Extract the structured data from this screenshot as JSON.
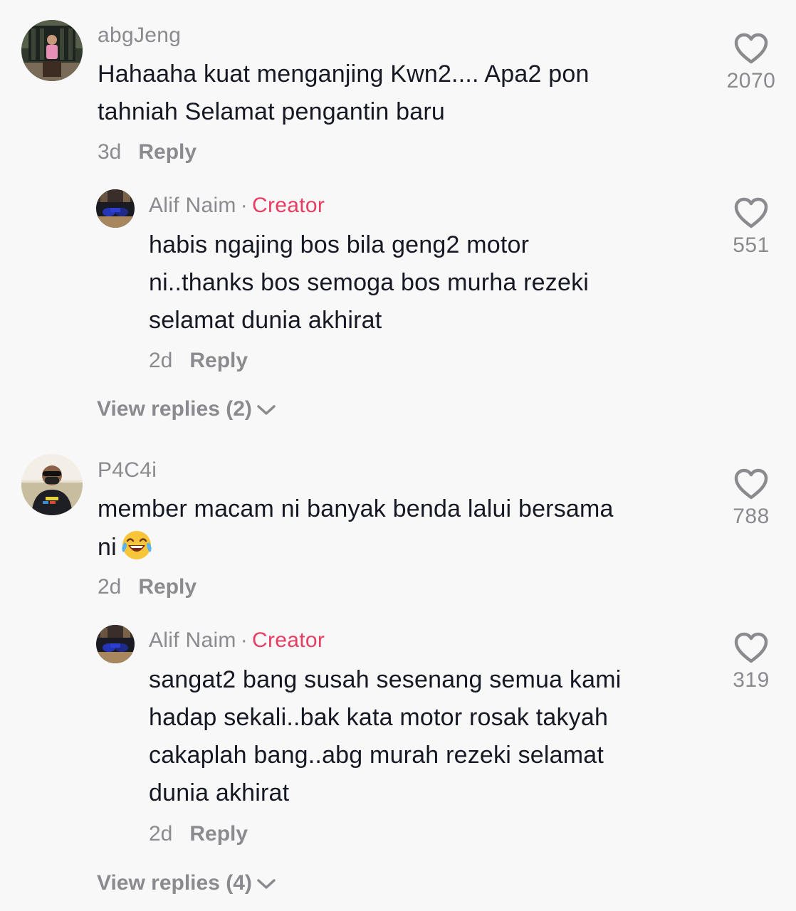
{
  "comments": [
    {
      "username": "abgJeng",
      "text_lines": [
        "Hahaaha kuat menganjing Kwn2.... Apa2 pon",
        "tahniah Selamat pengantin baru"
      ],
      "time": "3d",
      "reply_label": "Reply",
      "likes": "2070",
      "reply": {
        "username": "Alif Naim",
        "separator": "·",
        "badge": "Creator",
        "text_lines": [
          "habis ngajing bos bila geng2 motor",
          "ni..thanks bos semoga bos murha rezeki",
          "selamat dunia akhirat"
        ],
        "time": "2d",
        "reply_label": "Reply",
        "likes": "551"
      },
      "view_replies": "View replies (2)"
    },
    {
      "username": "P4C4i",
      "text_lines": [
        "member macam ni banyak benda lalui bersama",
        "ni"
      ],
      "emoji": "tears-of-joy-emoji",
      "time": "2d",
      "reply_label": "Reply",
      "likes": "788",
      "reply": {
        "username": "Alif Naim",
        "separator": "·",
        "badge": "Creator",
        "text_lines": [
          "sangat2 bang susah sesenang semua kami",
          "hadap sekali..bak kata motor rosak takyah",
          "cakaplah bang..abg murah rezeki selamat",
          "dunia akhirat"
        ],
        "time": "2d",
        "reply_label": "Reply",
        "likes": "319"
      },
      "view_replies": "View replies (4)"
    }
  ],
  "colors": {
    "background": "#f8f8f8",
    "text": "#161823",
    "muted": "#8a8a8f",
    "creator": "#e83d62"
  }
}
